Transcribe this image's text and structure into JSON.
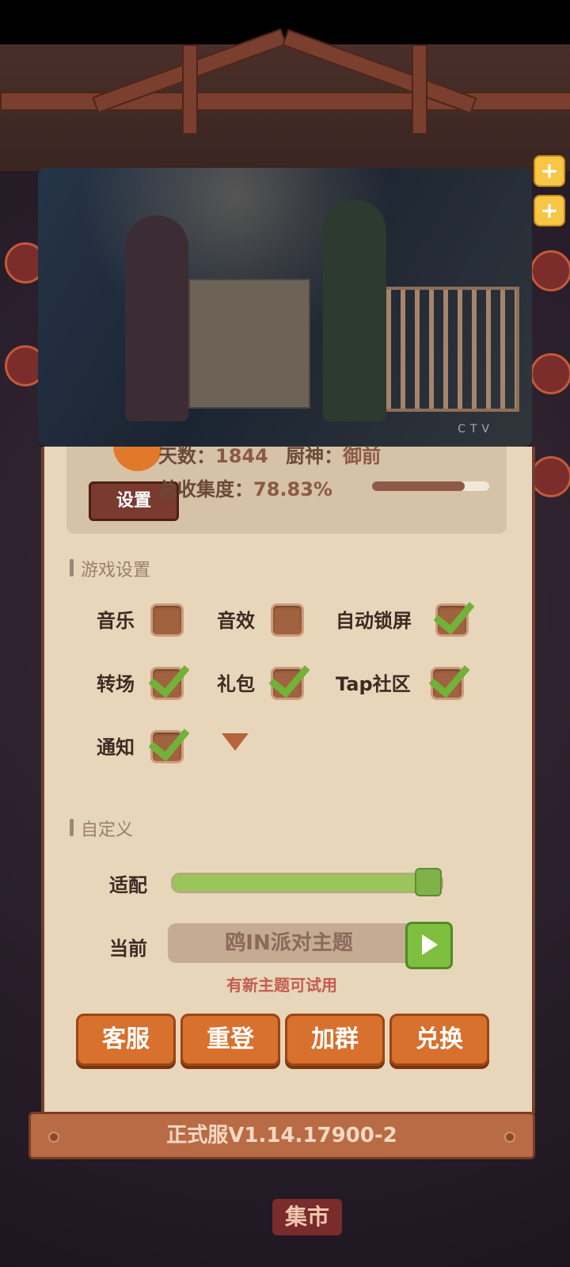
{
  "info": {
    "days_label": "天数：",
    "days_value": "1844",
    "chef_label": "厨神：",
    "chef_value": "御前",
    "collection_label": "总收集度：",
    "collection_value": "78.83%",
    "collection_fraction": 0.7883,
    "settings_tag": "设置"
  },
  "game_settings": {
    "title": "游戏设置",
    "options": [
      {
        "label": "音乐",
        "checked": false
      },
      {
        "label": "音效",
        "checked": false
      },
      {
        "label": "自动锁屏",
        "checked": true
      },
      {
        "label": "转场",
        "checked": true
      },
      {
        "label": "礼包",
        "checked": true
      },
      {
        "label": "Tap社区",
        "checked": true
      },
      {
        "label": "通知",
        "checked": true
      }
    ]
  },
  "custom": {
    "title": "自定义",
    "adapt_label": "适配",
    "adapt_value": 1.0,
    "current_label": "当前",
    "current_theme": "鸥IN派对主题",
    "hint": "有新主题可试用"
  },
  "actions": [
    "客服",
    "重登",
    "加群",
    "兑换"
  ],
  "footer": {
    "version": "正式服V1.14.17900-2"
  },
  "video": {
    "watermark": "CTV"
  },
  "background": {
    "market_sign": "集市"
  },
  "colors": {
    "accent_orange": "#d8702e",
    "check_green": "#72b23a",
    "panel_bg": "#e8d6bb"
  }
}
